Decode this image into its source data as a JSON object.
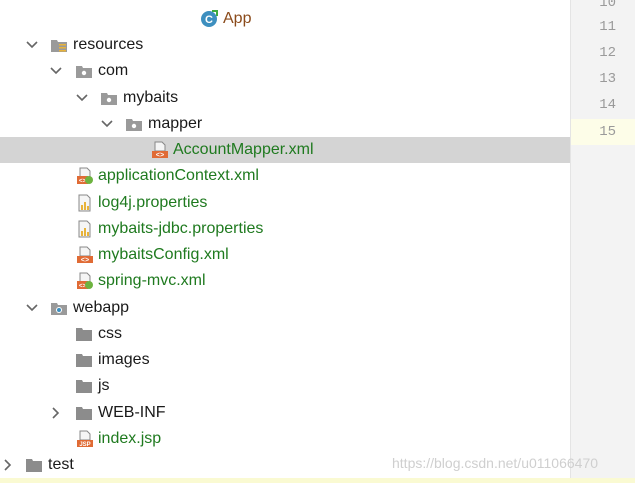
{
  "tree": {
    "items": [
      {
        "label": "App",
        "icon": "java-class-icon"
      },
      {
        "label": "resources",
        "icon": "resources-folder-icon"
      },
      {
        "label": "com",
        "icon": "package-icon"
      },
      {
        "label": "mybaits",
        "icon": "package-icon"
      },
      {
        "label": "mapper",
        "icon": "package-icon"
      },
      {
        "label": "AccountMapper.xml",
        "icon": "xml-file-icon"
      },
      {
        "label": "applicationContext.xml",
        "icon": "spring-xml-icon"
      },
      {
        "label": "log4j.properties",
        "icon": "properties-file-icon"
      },
      {
        "label": "mybaits-jdbc.properties",
        "icon": "properties-file-icon"
      },
      {
        "label": "mybaitsConfig.xml",
        "icon": "xml-file-icon"
      },
      {
        "label": "spring-mvc.xml",
        "icon": "spring-xml-icon"
      },
      {
        "label": "webapp",
        "icon": "web-folder-icon"
      },
      {
        "label": "css",
        "icon": "folder-icon"
      },
      {
        "label": "images",
        "icon": "folder-icon"
      },
      {
        "label": "js",
        "icon": "folder-icon"
      },
      {
        "label": "WEB-INF",
        "icon": "folder-icon"
      },
      {
        "label": "index.jsp",
        "icon": "jsp-file-icon"
      },
      {
        "label": "test",
        "icon": "folder-icon"
      }
    ]
  },
  "gutter": {
    "line_numbers": [
      "10",
      "11",
      "12",
      "13",
      "14",
      "15"
    ]
  },
  "watermark": "https://blog.csdn.net/u011066470",
  "colors": {
    "selection": "#d4d4d4",
    "green_label": "#1f7a1f",
    "class_label": "#8a4a1a",
    "folder_gray": "#8c8c8c",
    "xml_orange": "#e06b35"
  }
}
